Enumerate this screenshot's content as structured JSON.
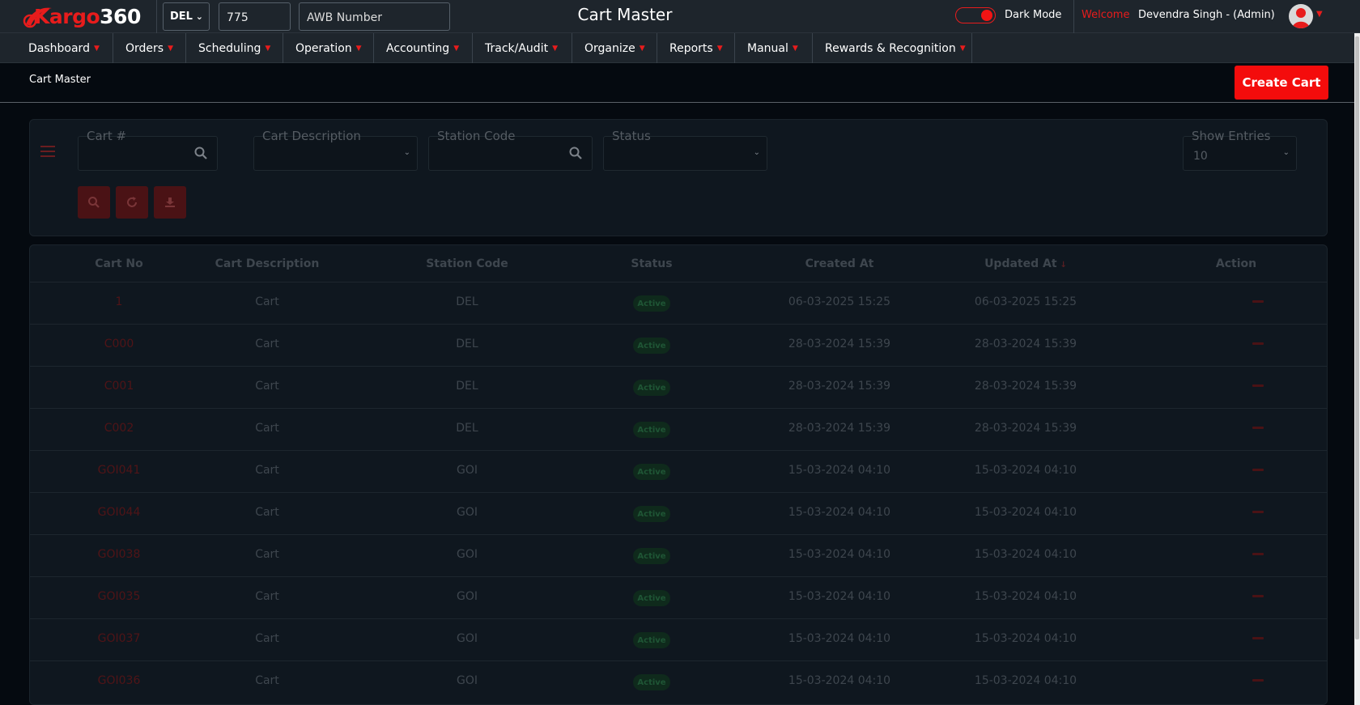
{
  "topbar": {
    "logo": "Kargo360",
    "station": "DEL",
    "awb_prefix": "775",
    "awb_placeholder": "AWB Number",
    "page_title": "Cart Master",
    "dark_mode_label": "Dark Mode",
    "dark_mode_on": true,
    "welcome": "Welcome",
    "user": "Devendra Singh - (Admin)"
  },
  "nav": [
    {
      "label": "Dashboard"
    },
    {
      "label": "Orders"
    },
    {
      "label": "Scheduling"
    },
    {
      "label": "Operation"
    },
    {
      "label": "Accounting"
    },
    {
      "label": "Track/Audit"
    },
    {
      "label": "Organize"
    },
    {
      "label": "Reports"
    },
    {
      "label": "Manual"
    },
    {
      "label": "Rewards & Recognition"
    }
  ],
  "breadcrumb": "Cart Master",
  "create_button": "Create Cart",
  "filters": {
    "cart_no_label": "Cart #",
    "cart_desc_label": "Cart Description",
    "station_label": "Station Code",
    "status_label": "Status",
    "entries_label": "Show Entries",
    "entries_value": "10"
  },
  "table": {
    "headers": [
      "Cart No",
      "Cart Description",
      "Station Code",
      "Status",
      "Created At",
      "Updated At",
      "Action"
    ],
    "rows": [
      {
        "cart_no": "1",
        "desc": "Cart",
        "station": "DEL",
        "status": "Active",
        "created": "06-03-2025 15:25",
        "updated": "06-03-2025 15:25"
      },
      {
        "cart_no": "C000",
        "desc": "Cart",
        "station": "DEL",
        "status": "Active",
        "created": "28-03-2024 15:39",
        "updated": "28-03-2024 15:39"
      },
      {
        "cart_no": "C001",
        "desc": "Cart",
        "station": "DEL",
        "status": "Active",
        "created": "28-03-2024 15:39",
        "updated": "28-03-2024 15:39"
      },
      {
        "cart_no": "C002",
        "desc": "Cart",
        "station": "DEL",
        "status": "Active",
        "created": "28-03-2024 15:39",
        "updated": "28-03-2024 15:39"
      },
      {
        "cart_no": "GOI041",
        "desc": "Cart",
        "station": "GOI",
        "status": "Active",
        "created": "15-03-2024 04:10",
        "updated": "15-03-2024 04:10"
      },
      {
        "cart_no": "GOI044",
        "desc": "Cart",
        "station": "GOI",
        "status": "Active",
        "created": "15-03-2024 04:10",
        "updated": "15-03-2024 04:10"
      },
      {
        "cart_no": "GOI038",
        "desc": "Cart",
        "station": "GOI",
        "status": "Active",
        "created": "15-03-2024 04:10",
        "updated": "15-03-2024 04:10"
      },
      {
        "cart_no": "GOI035",
        "desc": "Cart",
        "station": "GOI",
        "status": "Active",
        "created": "15-03-2024 04:10",
        "updated": "15-03-2024 04:10"
      },
      {
        "cart_no": "GOI037",
        "desc": "Cart",
        "station": "GOI",
        "status": "Active",
        "created": "15-03-2024 04:10",
        "updated": "15-03-2024 04:10"
      },
      {
        "cart_no": "GOI036",
        "desc": "Cart",
        "station": "GOI",
        "status": "Active",
        "created": "15-03-2024 04:10",
        "updated": "15-03-2024 04:10"
      }
    ]
  },
  "colors": {
    "accent": "#f40c0c",
    "bar_bg": "#1e252c",
    "page_bg": "#050a10",
    "panel_bg": "#0f171f"
  }
}
